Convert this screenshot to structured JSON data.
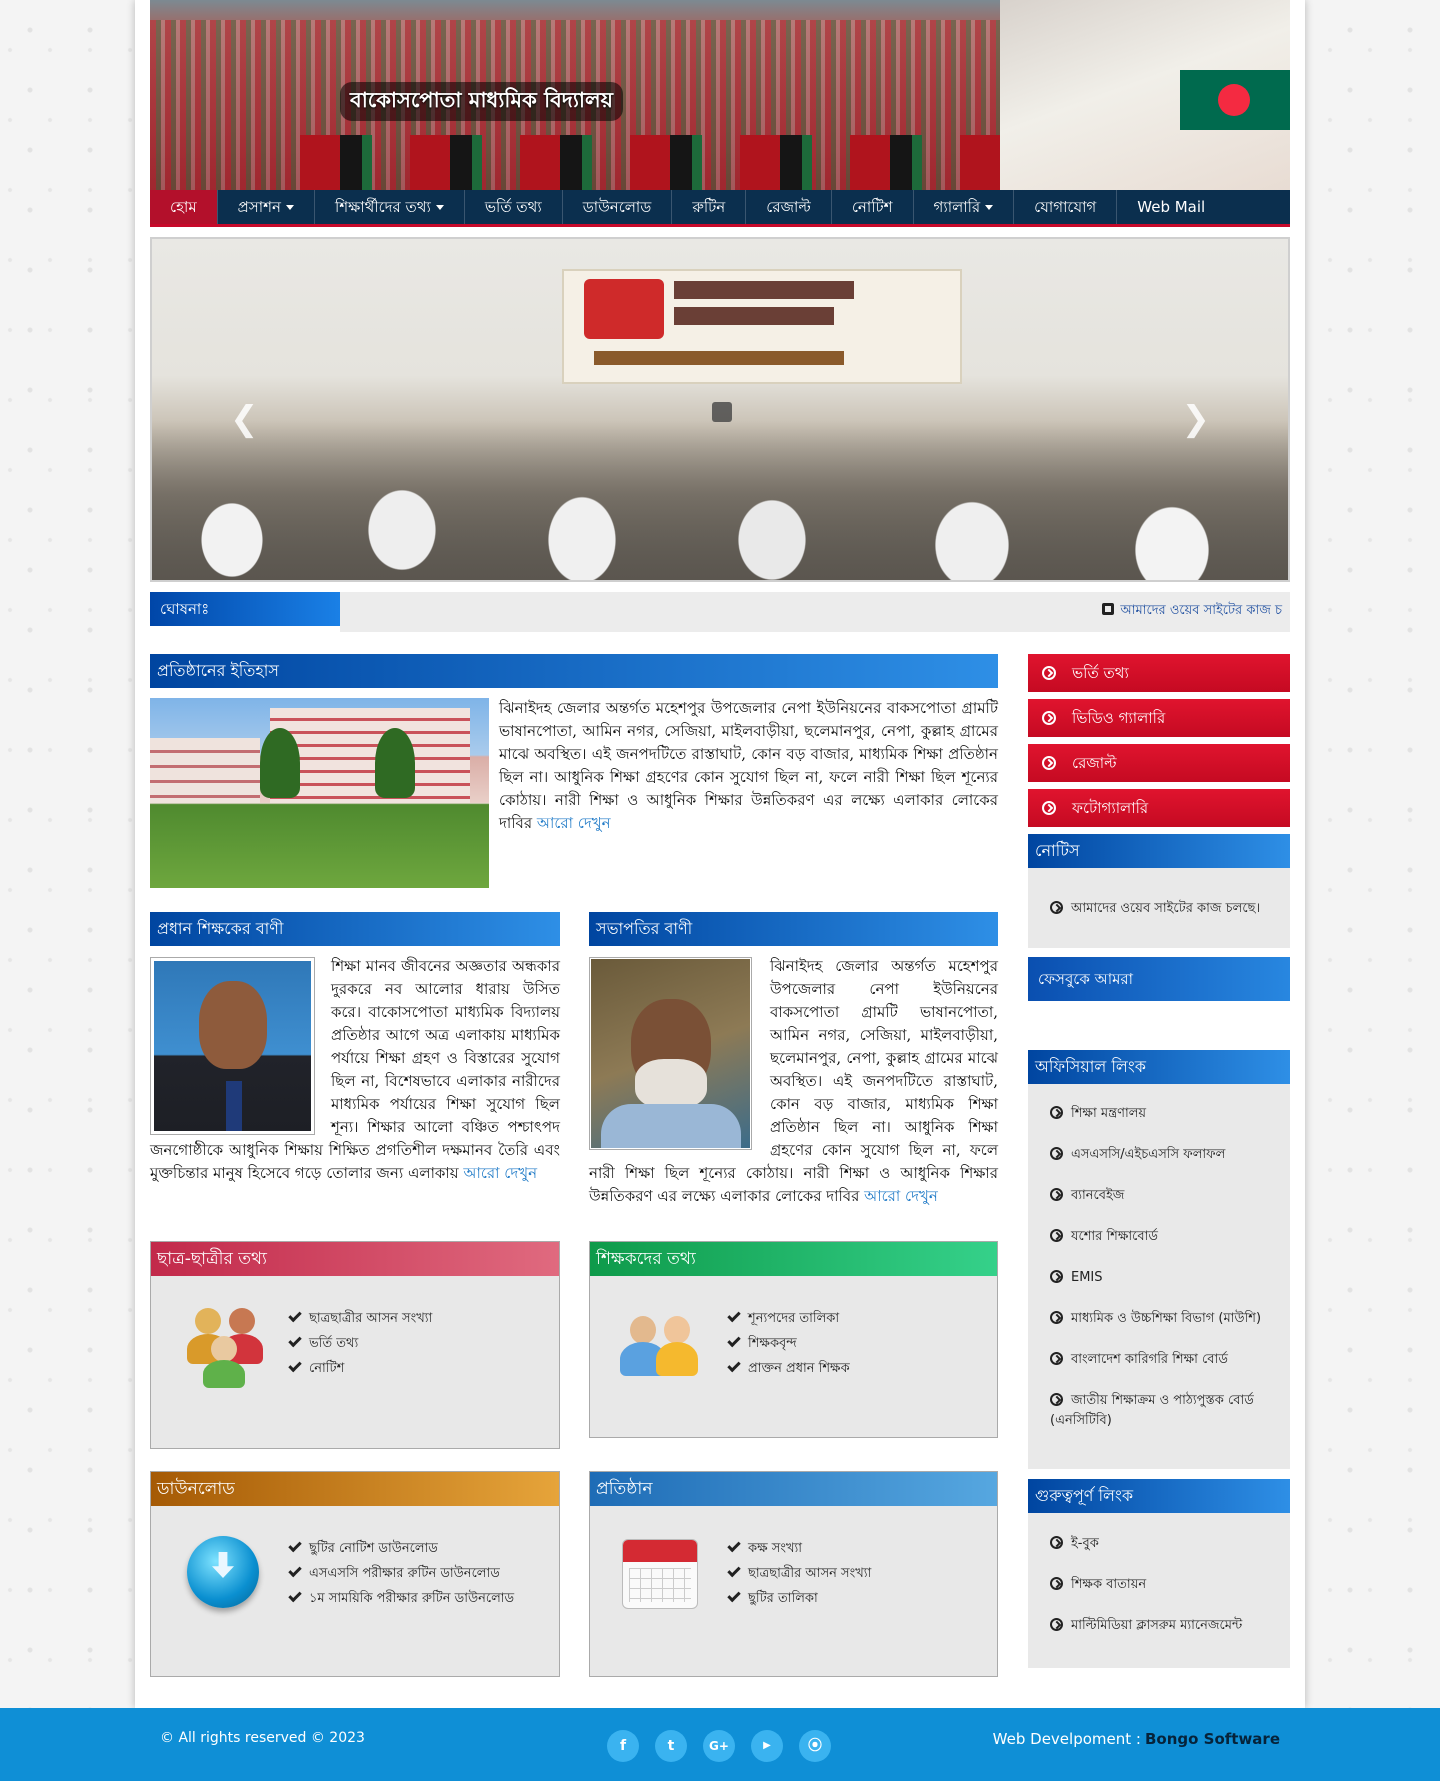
{
  "site": {
    "name": "বাকোসপোতা মাধ্যমিক বিদ্যালয়"
  },
  "nav": {
    "items": [
      {
        "label": "হোম",
        "dropdown": false
      },
      {
        "label": "প্রসাশন",
        "dropdown": true
      },
      {
        "label": "শিক্ষার্থীদের তথ্য",
        "dropdown": true
      },
      {
        "label": "ভর্তি তথ্য",
        "dropdown": false
      },
      {
        "label": "ডাউনলোড",
        "dropdown": false
      },
      {
        "label": "রুটিন",
        "dropdown": false
      },
      {
        "label": "রেজাল্ট",
        "dropdown": false
      },
      {
        "label": "নোটিশ",
        "dropdown": false
      },
      {
        "label": "গ্যালারি",
        "dropdown": true
      },
      {
        "label": "যোগাযোগ",
        "dropdown": false
      },
      {
        "label": "Web Mail",
        "dropdown": false
      }
    ]
  },
  "announcement": {
    "label": "ঘোষনাঃ",
    "text": "আমাদের ওয়েব সাইটের কাজ চ"
  },
  "history": {
    "title": "প্রতিষ্ঠানের ইতিহাস",
    "text": "ঝিনাইদহ জেলার অন্তর্গত মহেশপুর উপজেলার নেপা ইউনিয়নের বাকসপোতা গ্রামটি ভাষানপোতা, আমিন নগর, সেজিয়া, মাইলবাড়ীয়া, ছলেমানপুর, নেপা, কুল্লাহ গ্রামের মাঝে অবস্থিত। এই জনপদটিতে রাস্তাঘাট, কোন বড় বাজার, মাধ্যমিক শিক্ষা প্রতিষ্ঠান ছিল না। আধুনিক শিক্ষা গ্রহণের কোন সুযোগ ছিল না, ফলে নারী শিক্ষা ছিল শূন্যের কোঠায়। নারী শিক্ষা ও আধুনিক শিক্ষার উন্নতিকরণ এর লক্ষ্যে এলাকার লোকের দাবির ",
    "more": "আরো দেখুন"
  },
  "headmaster": {
    "title": "প্রধান শিক্ষকের বাণী",
    "text": "শিক্ষা মানব জীবনের অজ্ঞতার অন্ধকার দুরকরে নব আলোর ধারায় উসিত করে। বাকোসপোতা মাধ্যমিক বিদ্যালয় প্রতিষ্ঠার আগে অত্র এলাকায় মাধ্যমিক পর্যায়ে শিক্ষা গ্রহণ ও বিস্তারের সুযোগ ছিল না, বিশেষভাবে এলাকার নারীদের মাধ্যমিক পর্যায়ের শিক্ষা সুযোগ ছিল শূন্য। শিক্ষার আলো বঞ্চিত পশ্চাৎপদ জনগোষ্ঠীকে আধুনিক শিক্ষায় শিক্ষিত প্রগতিশীল দক্ষমানব তৈরি এবং মুক্তচিন্তার মানুষ হিসেবে গড়ে তোলার জন্য এলাকায় ",
    "more": "আরো দেখুন"
  },
  "chairman": {
    "title": "সভাপতির বাণী",
    "text": "ঝিনাইদহ জেলার অন্তর্গত মহেশপুর উপজেলার নেপা ইউনিয়নের বাকসপোতা গ্রামটি ভাষানপোতা, আমিন নগর, সেজিয়া, মাইলবাড়ীয়া, ছলেমানপুর, নেপা, কুল্লাহ গ্রামের মাঝে অবস্থিত। এই জনপদটিতে রাস্তাঘাট, কোন বড় বাজার, মাধ্যমিক শিক্ষা প্রতিষ্ঠান ছিল না। আধুনিক শিক্ষা গ্রহণের কোন সুযোগ ছিল না, ফলে নারী শিক্ষা ছিল শূন্যের কোঠায়। নারী শিক্ষা ও আধুনিক শিক্ষার উন্নতিকরণ এর লক্ষ্যে এলাকার লোকের দাবির ",
    "more": "আরো দেখুন"
  },
  "boxes": {
    "students": {
      "title": "ছাত্র-ছাত্রীর তথ্য",
      "items": [
        "ছাত্রছাত্রীর আসন সংখ্যা",
        "ভর্তি তথ্য",
        "নোটিশ"
      ]
    },
    "teachers": {
      "title": "শিক্ষকদের তথ্য",
      "items": [
        "শূন্যপদের তালিকা",
        "শিক্ষকবৃন্দ",
        "প্রাক্তন প্রধান শিক্ষক"
      ]
    },
    "downloads": {
      "title": "ডাউনলোড",
      "items": [
        "ছুটির নোটিশ ডাউনলোড",
        "এসএসসি পরীক্ষার রুটিন ডাউনলোড",
        "১ম সাময়িকি পরীক্ষার রুটিন ডাউনলোড"
      ]
    },
    "institution": {
      "title": "প্রতিষ্ঠান",
      "items": [
        "কক্ষ সংখ্যা",
        "ছাত্রছাত্রীর আসন সংখ্যা",
        "ছুটির তালিকা"
      ]
    }
  },
  "sidebar": {
    "buttons": [
      "ভর্তি তথ্য",
      "ভিডিও গ্যালারি",
      "রেজাল্ট",
      "ফটোগ্যালারি"
    ],
    "notice_title": "নোটিস",
    "notice_items": [
      "আমাদের ওয়েব সাইটের কাজ চলছে।"
    ],
    "facebook_title": "ফেসবুকে আমরা",
    "official_title": "অফিসিয়াল লিংক",
    "official_links": [
      "শিক্ষা মন্ত্রণালয়",
      "এসএসসি/এইচএসসি ফলাফল",
      "ব্যানবেইজ",
      "যশোর শিক্ষাবোর্ড",
      "EMIS",
      "মাধ্যমিক ও উচ্চশিক্ষা বিভাগ (মাউশি)",
      "বাংলাদেশ কারিগরি শিক্ষা বোর্ড",
      "জাতীয় শিক্ষাক্রম ও পাঠ্যপুস্তক বোর্ড (এনসিটিবি)"
    ],
    "important_title": "গুরুত্বপূর্ণ লিংক",
    "important_links": [
      "ই-বুক",
      "শিক্ষক বাতায়ন",
      "মাল্টিমিডিয়া ক্লাসরুম ম্যানেজমেন্ট"
    ]
  },
  "footer": {
    "copyright": "© All rights reserved © 2023",
    "dev_label": "Web Develpoment :",
    "dev_name": "Bongo Software",
    "social": [
      "facebook-icon",
      "twitter-icon",
      "google-plus-icon",
      "youtube-icon",
      "rss-icon"
    ]
  },
  "colors": {
    "nav": "#0b2f4e",
    "accent_red": "#c7092a",
    "header_blue": "#0045a0",
    "footer": "#0f8fd6"
  }
}
